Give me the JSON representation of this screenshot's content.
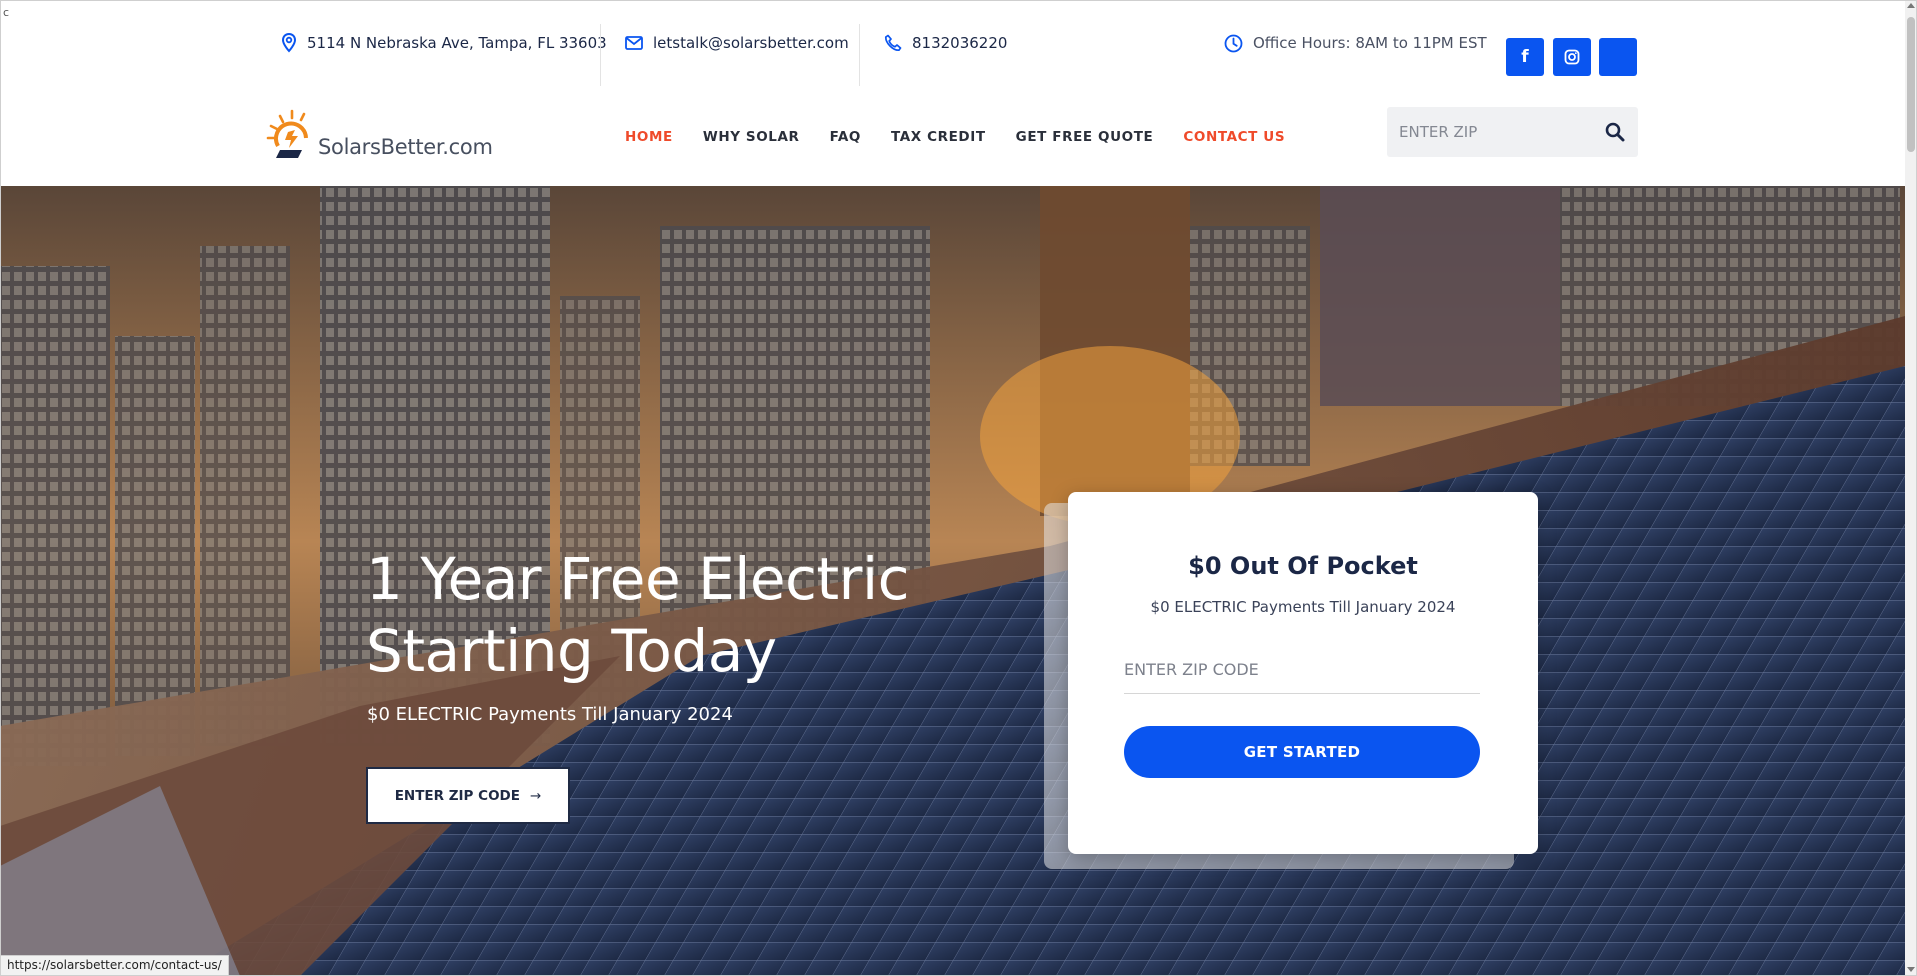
{
  "corner_char": "c",
  "topbar": {
    "address": "5114 N Nebraska Ave, Tampa, FL 33603",
    "email": "letstalk@solarsbetter.com",
    "phone": "8132036220",
    "hours": "Office Hours: 8AM to 11PM EST",
    "social": [
      {
        "name": "facebook-icon",
        "glyph": "f"
      },
      {
        "name": "instagram-icon",
        "glyph": ""
      },
      {
        "name": "social-link-icon",
        "glyph": ""
      }
    ]
  },
  "logo": {
    "text": "SolarsBetter.com"
  },
  "nav": {
    "items": [
      {
        "label": "HOME",
        "state": "active"
      },
      {
        "label": "WHY SOLAR"
      },
      {
        "label": "FAQ"
      },
      {
        "label": "TAX CREDIT"
      },
      {
        "label": "GET FREE QUOTE"
      },
      {
        "label": "CONTACT US",
        "state": "highlighted"
      }
    ],
    "zip_placeholder": "ENTER ZIP"
  },
  "hero": {
    "title_line1": "1 Year Free Electric",
    "title_line2": "Starting Today",
    "subtitle": "$0 ELECTRIC Payments Till January 2024",
    "button_label": "ENTER ZIP CODE",
    "button_arrow": "→"
  },
  "card": {
    "title": "$0 Out Of Pocket",
    "subtitle": "$0 ELECTRIC Payments Till January 2024",
    "input_placeholder": "ENTER ZIP CODE",
    "button_label": "GET STARTED"
  },
  "status_bar": {
    "url": "https://solarsbetter.com/contact-us/"
  },
  "colors": {
    "accent_blue": "#0a55f0",
    "accent_orange": "#ef4a2a",
    "dark_navy": "#1b2746"
  }
}
